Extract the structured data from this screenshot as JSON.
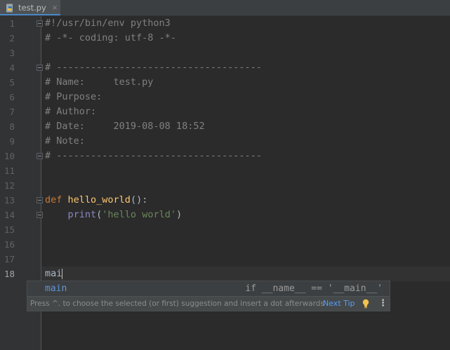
{
  "tab": {
    "filename": "test.py",
    "close_glyph": "×",
    "icon": "python-file-icon"
  },
  "code_lines": [
    {
      "number": "1",
      "text": "#!/usr/bin/env python3"
    },
    {
      "number": "2",
      "text": "# -*- coding: utf-8 -*-"
    },
    {
      "number": "3",
      "text": ""
    },
    {
      "number": "4",
      "text": "# ------------------------------------"
    },
    {
      "number": "5",
      "text": "# Name:     test.py"
    },
    {
      "number": "6",
      "text": "# Purpose:"
    },
    {
      "number": "7",
      "text": "# Author:"
    },
    {
      "number": "8",
      "text": "# Date:     2019-08-08 18:52"
    },
    {
      "number": "9",
      "text": "# Note:"
    },
    {
      "number": "10",
      "text": "# ------------------------------------"
    },
    {
      "number": "11",
      "text": ""
    },
    {
      "number": "12",
      "text": ""
    },
    {
      "number": "13",
      "def_kw": "def",
      "fn_name": "hello_world",
      "rest": "():"
    },
    {
      "number": "14",
      "indent": "    ",
      "builtin": "print",
      "open": "(",
      "string": "'hello world'",
      "close": ")"
    },
    {
      "number": "15",
      "text": ""
    },
    {
      "number": "16",
      "text": ""
    },
    {
      "number": "17",
      "text": ""
    },
    {
      "number": "18",
      "text": "mai"
    }
  ],
  "autocomplete": {
    "suggestion": "main",
    "suggestion_match": "mai",
    "suggestion_rest": "n",
    "tail_text": "if __name__ == '__main__'",
    "hint_text": "Press ^. to choose the selected (or first) suggestion and insert a dot afterwards",
    "next_tip": "Next Tip",
    "more_glyph": "⋮",
    "icons": [
      "lightbulb-icon",
      "more-options-icon"
    ]
  },
  "colors": {
    "background": "#2b2b2b",
    "comment": "#808080",
    "keyword": "#cc7832",
    "function": "#ffc66d",
    "builtin": "#8888c6",
    "string": "#6a8759",
    "link": "#589df6"
  }
}
